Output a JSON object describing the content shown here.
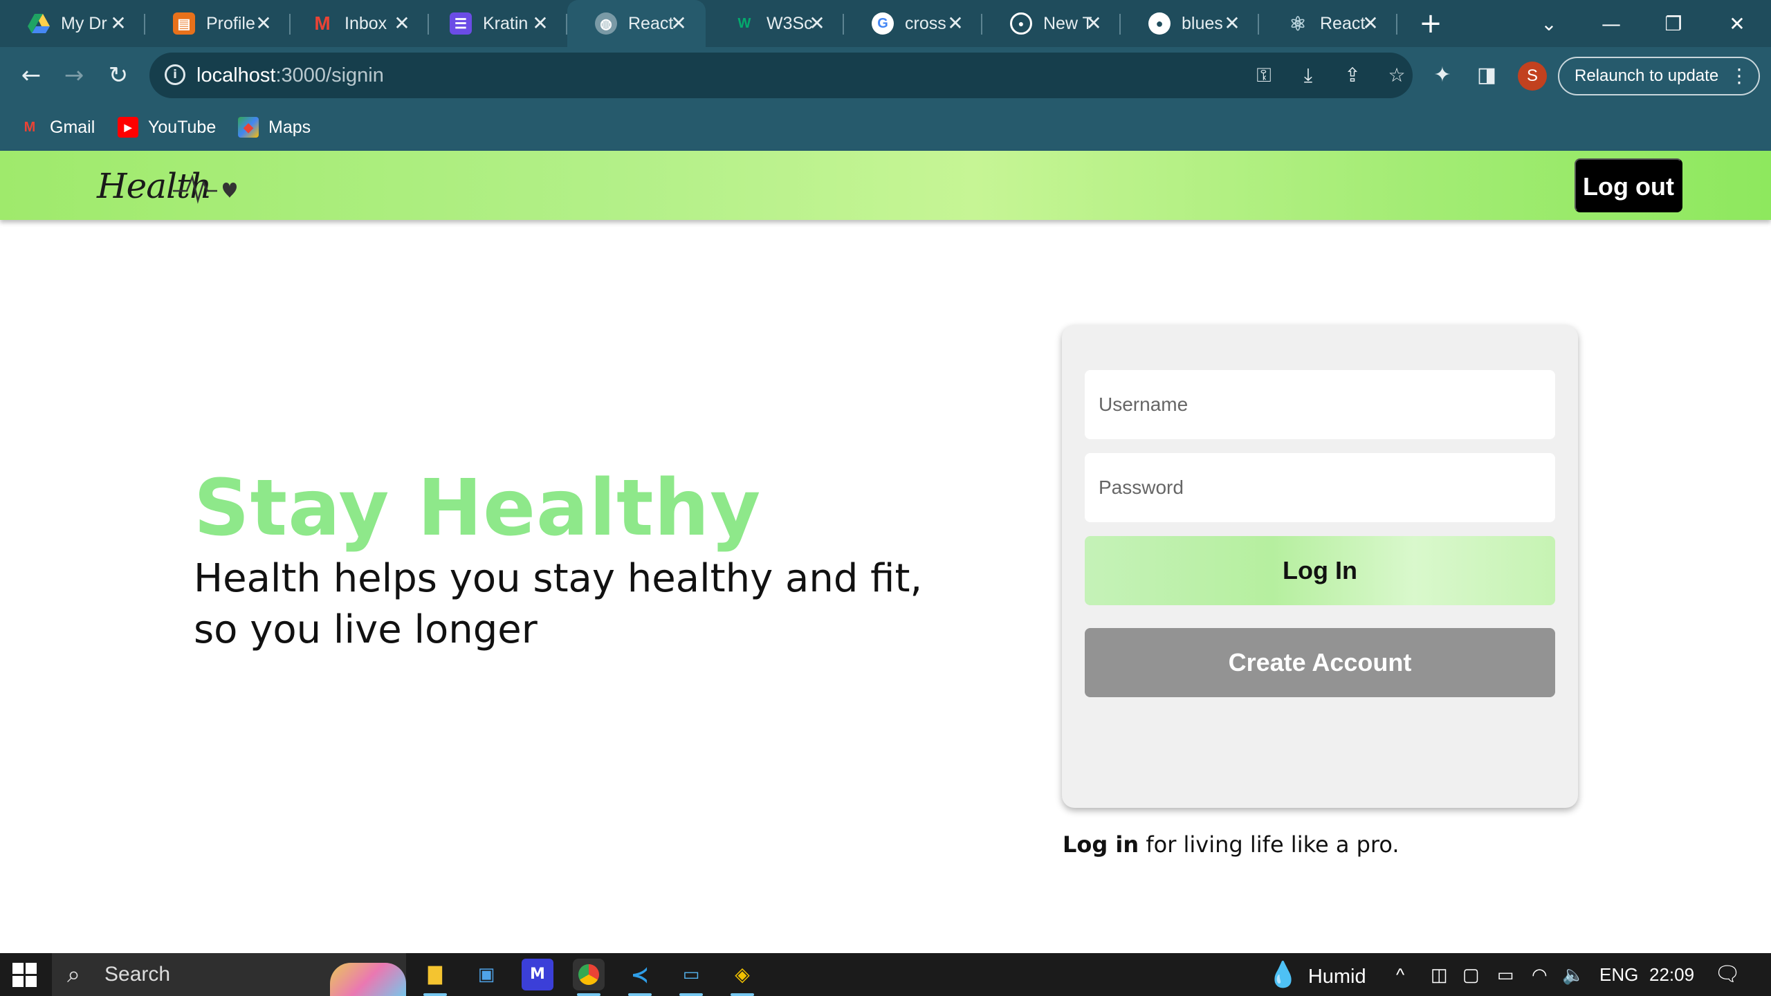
{
  "browser": {
    "tabs": [
      {
        "title": "My Dr",
        "icon": "google-drive-icon",
        "color": "#1fa463"
      },
      {
        "title": "Profile",
        "icon": "profile-site-icon",
        "color": "#e8711b"
      },
      {
        "title": "Inbox",
        "icon": "gmail-icon",
        "color": "#ea4335"
      },
      {
        "title": "Kratin",
        "icon": "list-app-icon",
        "color": "#6b4ce6"
      },
      {
        "title": "React",
        "icon": "globe-icon",
        "color": "#7a9aa6",
        "active": true
      },
      {
        "title": "W3Sc",
        "icon": "w3schools-icon",
        "color": "#04aa6d"
      },
      {
        "title": "cross",
        "icon": "google-icon",
        "color": "#ffffff"
      },
      {
        "title": "New T",
        "icon": "chrome-icon",
        "color": "#ffffff"
      },
      {
        "title": "blues",
        "icon": "github-icon",
        "color": "#ffffff"
      },
      {
        "title": "React",
        "icon": "react-icon",
        "color": "#61dafb"
      }
    ],
    "url_host": "localhost",
    "url_path": ":3000/signin",
    "relaunch_label": "Relaunch to update",
    "profile_initial": "S",
    "bookmarks": [
      {
        "label": "Gmail",
        "icon": "gmail-icon"
      },
      {
        "label": "YouTube",
        "icon": "youtube-icon"
      },
      {
        "label": "Maps",
        "icon": "maps-icon"
      }
    ]
  },
  "app": {
    "logo_text": "Health",
    "logout_label": "Log out",
    "hero_title": "Stay Healthy",
    "hero_text": "Health helps you stay healthy and fit, so you live longer",
    "username_placeholder": "Username",
    "password_placeholder": "Password",
    "login_label": "Log In",
    "create_label": "Create Account",
    "tagline_bold": "Log in",
    "tagline_rest": " for living life like a pro.",
    "colors": {
      "header_green": "#b3f088",
      "hero_green": "#8ee88a",
      "create_gray": "#939393"
    }
  },
  "taskbar": {
    "search_label": "Search",
    "weather_label": "Humid",
    "language": "ENG",
    "time": "22:09"
  }
}
